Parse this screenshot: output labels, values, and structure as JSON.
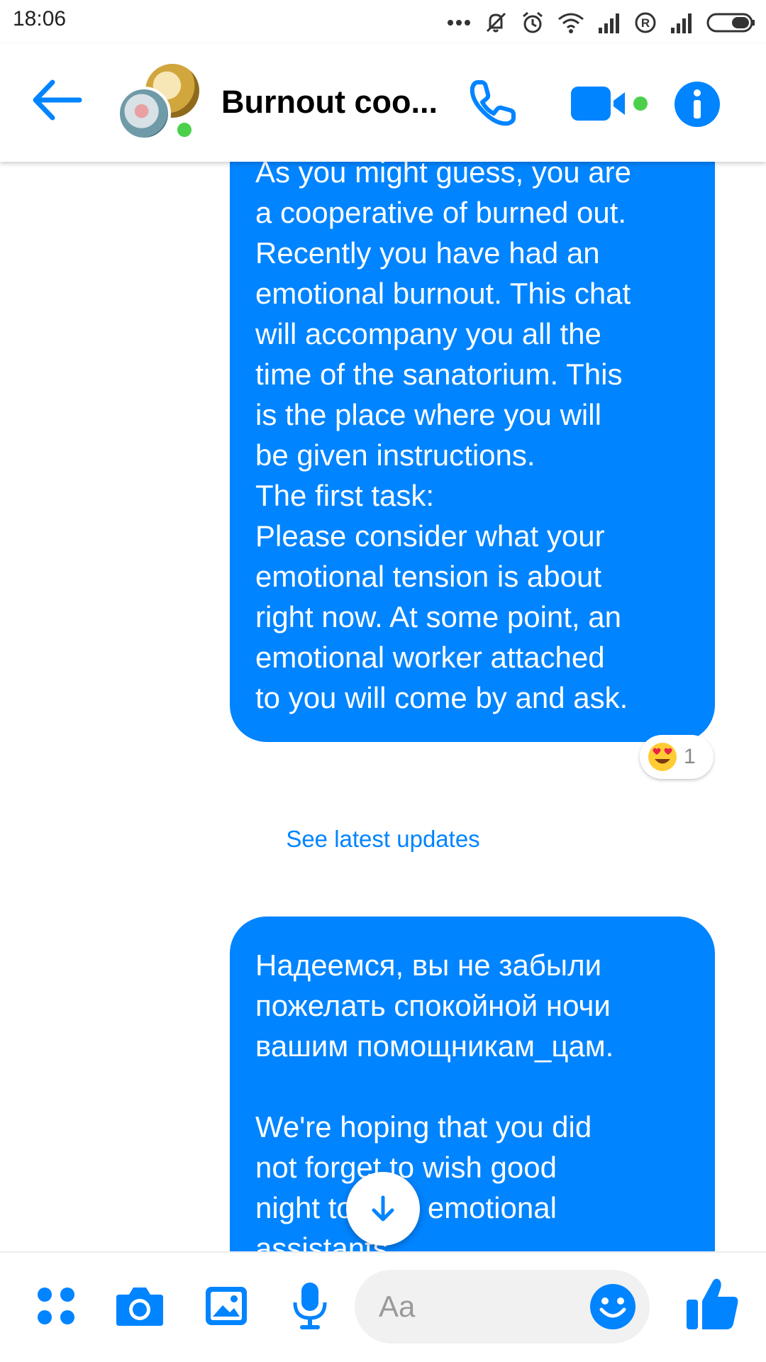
{
  "status_bar": {
    "time": "18:06",
    "icons": [
      "more-dots-icon",
      "mute-icon",
      "alarm-icon",
      "wifi-icon",
      "signal-icon",
      "registered-icon",
      "signal-icon",
      "battery-icon"
    ]
  },
  "header": {
    "title": "Burnout coo...",
    "online": true,
    "actions": [
      "back-arrow-icon",
      "phone-icon",
      "video-camera-icon",
      "info-icon"
    ]
  },
  "messages": [
    {
      "lines": [
        "As you might guess, you are",
        "a cooperative of burned out.",
        "Recently you have had an",
        "emotional burnout. This chat",
        "will accompany you all the",
        "time of the sanatorium. This",
        "is the place where you will",
        "be given instructions.",
        "The first task:",
        "Please consider what your",
        "emotional tension is about",
        "right now. At some point, an",
        "emotional worker attached",
        "to you will come by and ask."
      ],
      "reaction": {
        "emoji": "heart-eyes-icon",
        "count": "1"
      }
    },
    {
      "lines": [
        "Надеемся, вы не забыли",
        "пожелать спокойной ночи",
        "вашим помощникам_цам.",
        "",
        "We're hoping that you did",
        "not forget to wish good",
        "night to your emotional",
        "assistants."
      ]
    }
  ],
  "divider": {
    "label": "See latest updates"
  },
  "composer": {
    "placeholder": "Aa",
    "buttons": [
      "apps-icon",
      "camera-icon",
      "gallery-icon",
      "microphone-icon",
      "emoji-icon",
      "thumbs-up-icon"
    ]
  },
  "colors": {
    "accent": "#0084ff",
    "online": "#4cd04c",
    "bubble_text": "#ffffff"
  }
}
